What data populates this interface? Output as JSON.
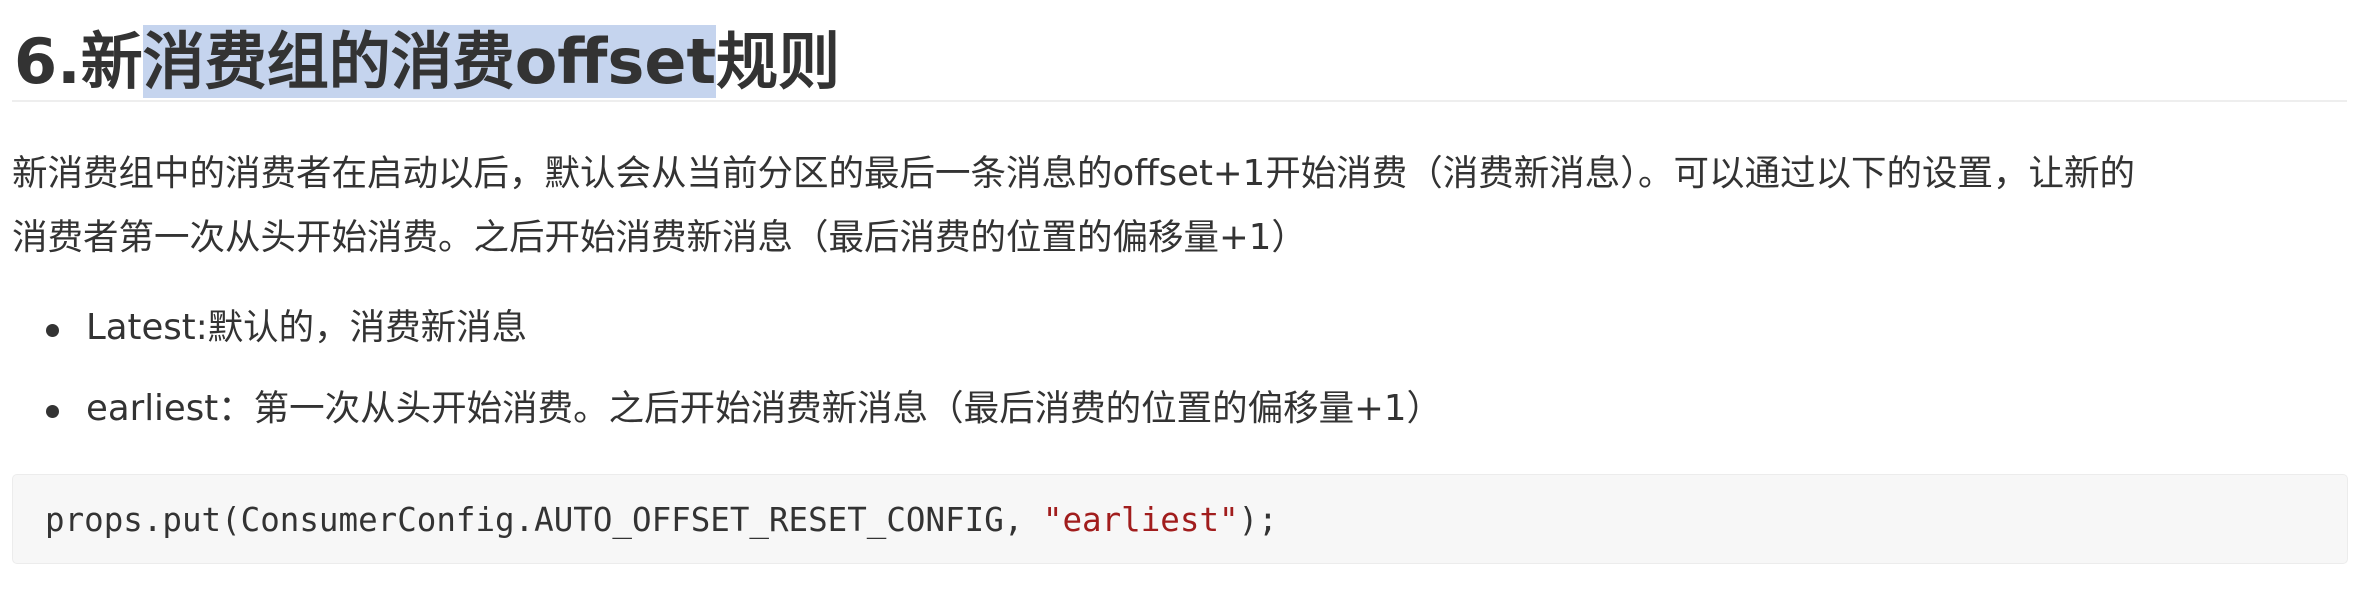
{
  "heading": {
    "prefix": "6.新",
    "highlighted": "消费组的消费offset",
    "suffix": "规则"
  },
  "paragraph": {
    "line1": "新消费组中的消费者在启动以后，默认会从当前分区的最后一条消息的offset+1开始消费（消费新消息）。可以通过以下的设置，让新的",
    "line2": "消费者第一次从头开始消费。之后开始消费新消息（最后消费的位置的偏移量+1）"
  },
  "bullets": [
    "Latest:默认的，消费新消息",
    "earliest：第一次从头开始消费。之后开始消费新消息（最后消费的位置的偏移量+1）"
  ],
  "code": {
    "prefix": "props.put(ConsumerConfig.AUTO_OFFSET_RESET_CONFIG, ",
    "string": "\"earliest\"",
    "suffix": ");"
  },
  "colors": {
    "highlight": "#c5d4ee",
    "text": "#333333",
    "code_background": "#f7f7f7",
    "code_string": "#a11d1d"
  }
}
